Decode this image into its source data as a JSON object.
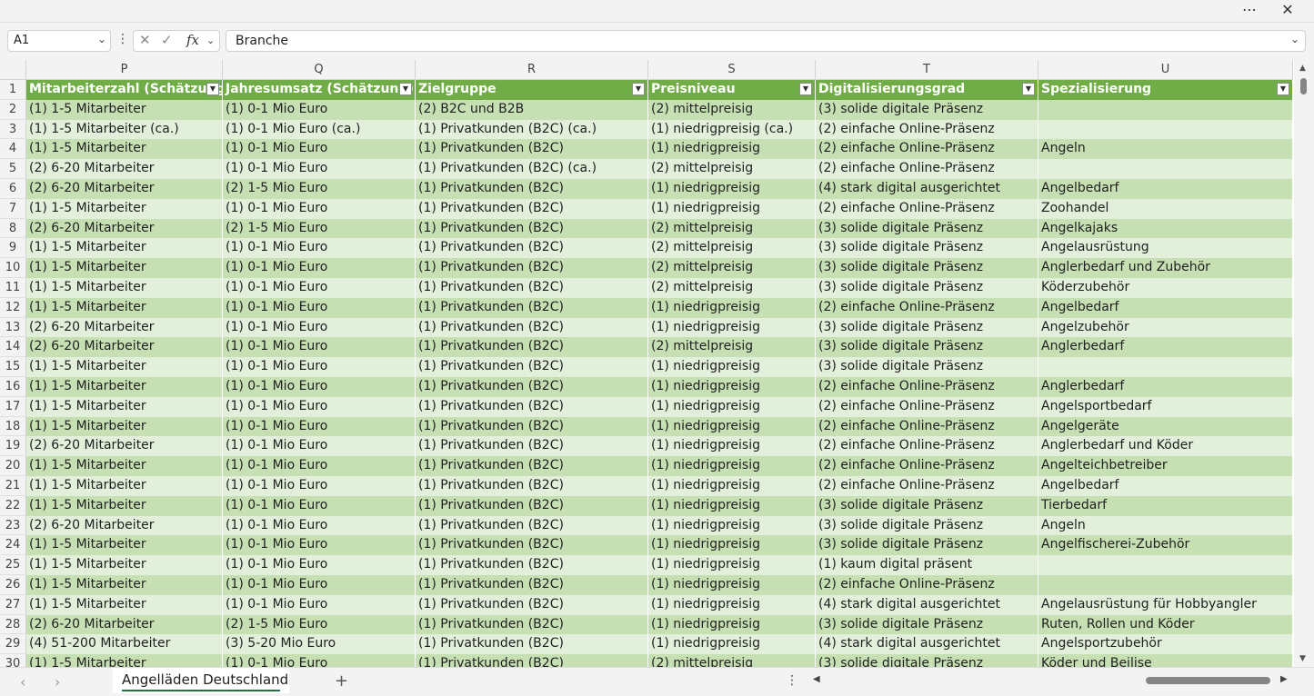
{
  "window": {
    "more_icon": "ellipsis-icon",
    "close_icon": "close-icon"
  },
  "formula": {
    "name_box": "A1",
    "fx_label": "fx",
    "content": "Branche"
  },
  "columns": [
    "P",
    "Q",
    "R",
    "S",
    "T",
    "U"
  ],
  "headers": [
    "Mitarbeiterzahl (Schätzung)",
    "Jahresumsatz (Schätzung)",
    "Zielgruppe",
    "Preisniveau",
    "Digitalisierungsgrad",
    "Spezialisierung"
  ],
  "rows": [
    {
      "n": "2",
      "cells": [
        "(1) 1-5 Mitarbeiter",
        "(1) 0-1 Mio Euro",
        "(2) B2C und B2B",
        "(2) mittelpreisig",
        "(3) solide digitale Präsenz",
        ""
      ]
    },
    {
      "n": "3",
      "cells": [
        "(1) 1-5 Mitarbeiter (ca.)",
        "(1) 0-1 Mio Euro (ca.)",
        "(1) Privatkunden (B2C) (ca.)",
        "(1) niedrigpreisig (ca.)",
        "(2) einfache Online-Präsenz",
        ""
      ]
    },
    {
      "n": "4",
      "cells": [
        "(1) 1-5 Mitarbeiter",
        "(1) 0-1 Mio Euro",
        "(1) Privatkunden (B2C)",
        "(1) niedrigpreisig",
        "(2) einfache Online-Präsenz",
        "Angeln"
      ]
    },
    {
      "n": "5",
      "cells": [
        "(2) 6-20 Mitarbeiter",
        "(1) 0-1 Mio Euro",
        "(1) Privatkunden (B2C) (ca.)",
        "(2) mittelpreisig",
        "(2) einfache Online-Präsenz",
        ""
      ]
    },
    {
      "n": "6",
      "cells": [
        "(2) 6-20 Mitarbeiter",
        "(2) 1-5 Mio Euro",
        "(1) Privatkunden (B2C)",
        "(1) niedrigpreisig",
        "(4) stark digital ausgerichtet",
        "Angelbedarf"
      ]
    },
    {
      "n": "7",
      "cells": [
        "(1) 1-5 Mitarbeiter",
        "(1) 0-1 Mio Euro",
        "(1) Privatkunden (B2C)",
        "(1) niedrigpreisig",
        "(2) einfache Online-Präsenz",
        "Zoohandel"
      ]
    },
    {
      "n": "8",
      "cells": [
        "(2) 6-20 Mitarbeiter",
        "(2) 1-5 Mio Euro",
        "(1) Privatkunden (B2C)",
        "(2) mittelpreisig",
        "(3) solide digitale Präsenz",
        "Angelkajaks"
      ]
    },
    {
      "n": "9",
      "cells": [
        "(1) 1-5 Mitarbeiter",
        "(1) 0-1 Mio Euro",
        "(1) Privatkunden (B2C)",
        "(2) mittelpreisig",
        "(3) solide digitale Präsenz",
        "Angelausrüstung"
      ]
    },
    {
      "n": "10",
      "cells": [
        "(1) 1-5 Mitarbeiter",
        "(1) 0-1 Mio Euro",
        "(1) Privatkunden (B2C)",
        "(2) mittelpreisig",
        "(3) solide digitale Präsenz",
        "Anglerbedarf und Zubehör"
      ]
    },
    {
      "n": "11",
      "cells": [
        "(1) 1-5 Mitarbeiter",
        "(1) 0-1 Mio Euro",
        "(1) Privatkunden (B2C)",
        "(2) mittelpreisig",
        "(3) solide digitale Präsenz",
        "Köderzubehör"
      ]
    },
    {
      "n": "12",
      "cells": [
        "(1) 1-5 Mitarbeiter",
        "(1) 0-1 Mio Euro",
        "(1) Privatkunden (B2C)",
        "(1) niedrigpreisig",
        "(2) einfache Online-Präsenz",
        "Angelbedarf"
      ]
    },
    {
      "n": "13",
      "cells": [
        "(2) 6-20 Mitarbeiter",
        "(1) 0-1 Mio Euro",
        "(1) Privatkunden (B2C)",
        "(1) niedrigpreisig",
        "(3) solide digitale Präsenz",
        "Angelzubehör"
      ]
    },
    {
      "n": "14",
      "cells": [
        "(2) 6-20 Mitarbeiter",
        "(1) 0-1 Mio Euro",
        "(1) Privatkunden (B2C)",
        "(2) mittelpreisig",
        "(3) solide digitale Präsenz",
        "Anglerbedarf"
      ]
    },
    {
      "n": "15",
      "cells": [
        "(1) 1-5 Mitarbeiter",
        "(1) 0-1 Mio Euro",
        "(1) Privatkunden (B2C)",
        "(1) niedrigpreisig",
        "(3) solide digitale Präsenz",
        ""
      ]
    },
    {
      "n": "16",
      "cells": [
        "(1) 1-5 Mitarbeiter",
        "(1) 0-1 Mio Euro",
        "(1) Privatkunden (B2C)",
        "(1) niedrigpreisig",
        "(2) einfache Online-Präsenz",
        "Anglerbedarf"
      ]
    },
    {
      "n": "17",
      "cells": [
        "(1) 1-5 Mitarbeiter",
        "(1) 0-1 Mio Euro",
        "(1) Privatkunden (B2C)",
        "(1) niedrigpreisig",
        "(2) einfache Online-Präsenz",
        "Angelsportbedarf"
      ]
    },
    {
      "n": "18",
      "cells": [
        "(1) 1-5 Mitarbeiter",
        "(1) 0-1 Mio Euro",
        "(1) Privatkunden (B2C)",
        "(1) niedrigpreisig",
        "(2) einfache Online-Präsenz",
        "Angelgeräte"
      ]
    },
    {
      "n": "19",
      "cells": [
        "(2) 6-20 Mitarbeiter",
        "(1) 0-1 Mio Euro",
        "(1) Privatkunden (B2C)",
        "(1) niedrigpreisig",
        "(2) einfache Online-Präsenz",
        "Anglerbedarf und Köder"
      ]
    },
    {
      "n": "20",
      "cells": [
        "(1) 1-5 Mitarbeiter",
        "(1) 0-1 Mio Euro",
        "(1) Privatkunden (B2C)",
        "(1) niedrigpreisig",
        "(2) einfache Online-Präsenz",
        "Angelteichbetreiber"
      ]
    },
    {
      "n": "21",
      "cells": [
        "(1) 1-5 Mitarbeiter",
        "(1) 0-1 Mio Euro",
        "(1) Privatkunden (B2C)",
        "(1) niedrigpreisig",
        "(2) einfache Online-Präsenz",
        "Angelbedarf"
      ]
    },
    {
      "n": "22",
      "cells": [
        "(1) 1-5 Mitarbeiter",
        "(1) 0-1 Mio Euro",
        "(1) Privatkunden (B2C)",
        "(1) niedrigpreisig",
        "(3) solide digitale Präsenz",
        "Tierbedarf"
      ]
    },
    {
      "n": "23",
      "cells": [
        "(2) 6-20 Mitarbeiter",
        "(1) 0-1 Mio Euro",
        "(1) Privatkunden (B2C)",
        "(1) niedrigpreisig",
        "(3) solide digitale Präsenz",
        "Angeln"
      ]
    },
    {
      "n": "24",
      "cells": [
        "(1) 1-5 Mitarbeiter",
        "(1) 0-1 Mio Euro",
        "(1) Privatkunden (B2C)",
        "(1) niedrigpreisig",
        "(3) solide digitale Präsenz",
        "Angelfischerei-Zubehör"
      ]
    },
    {
      "n": "25",
      "cells": [
        "(1) 1-5 Mitarbeiter",
        "(1) 0-1 Mio Euro",
        "(1) Privatkunden (B2C)",
        "(1) niedrigpreisig",
        "(1) kaum digital präsent",
        ""
      ]
    },
    {
      "n": "26",
      "cells": [
        "(1) 1-5 Mitarbeiter",
        "(1) 0-1 Mio Euro",
        "(1) Privatkunden (B2C)",
        "(1) niedrigpreisig",
        "(2) einfache Online-Präsenz",
        ""
      ]
    },
    {
      "n": "27",
      "cells": [
        "(1) 1-5 Mitarbeiter",
        "(1) 0-1 Mio Euro",
        "(1) Privatkunden (B2C)",
        "(1) niedrigpreisig",
        "(4) stark digital ausgerichtet",
        "Angelausrüstung für Hobbyangler"
      ]
    },
    {
      "n": "28",
      "cells": [
        "(2) 6-20 Mitarbeiter",
        "(2) 1-5 Mio Euro",
        "(1) Privatkunden (B2C)",
        "(1) niedrigpreisig",
        "(3) solide digitale Präsenz",
        "Ruten, Rollen und Köder"
      ]
    },
    {
      "n": "29",
      "cells": [
        "(4) 51-200 Mitarbeiter",
        "(3) 5-20 Mio Euro",
        "(1) Privatkunden (B2C)",
        "(1) niedrigpreisig",
        "(4) stark digital ausgerichtet",
        "Angelsportzubehör"
      ]
    },
    {
      "n": "30",
      "cells": [
        "(1) 1-5 Mitarbeiter",
        "(1) 0-1 Mio Euro",
        "(1) Privatkunden (B2C)",
        "(2) mittelpreisig",
        "(3) solide digitale Präsenz",
        "Köder und Beilise"
      ]
    }
  ],
  "colors": {
    "header_fill": "#70ad47",
    "band_dark": "#c6e0b4",
    "band_light": "#e2efda",
    "accent": "#217346"
  },
  "sheets": [
    "Angelläden Deutschland"
  ],
  "icons": {
    "prev_sheet": "chevron-left-icon",
    "next_sheet": "chevron-right-icon",
    "add_sheet": "plus-icon",
    "filter": "dropdown-filter-icon"
  }
}
